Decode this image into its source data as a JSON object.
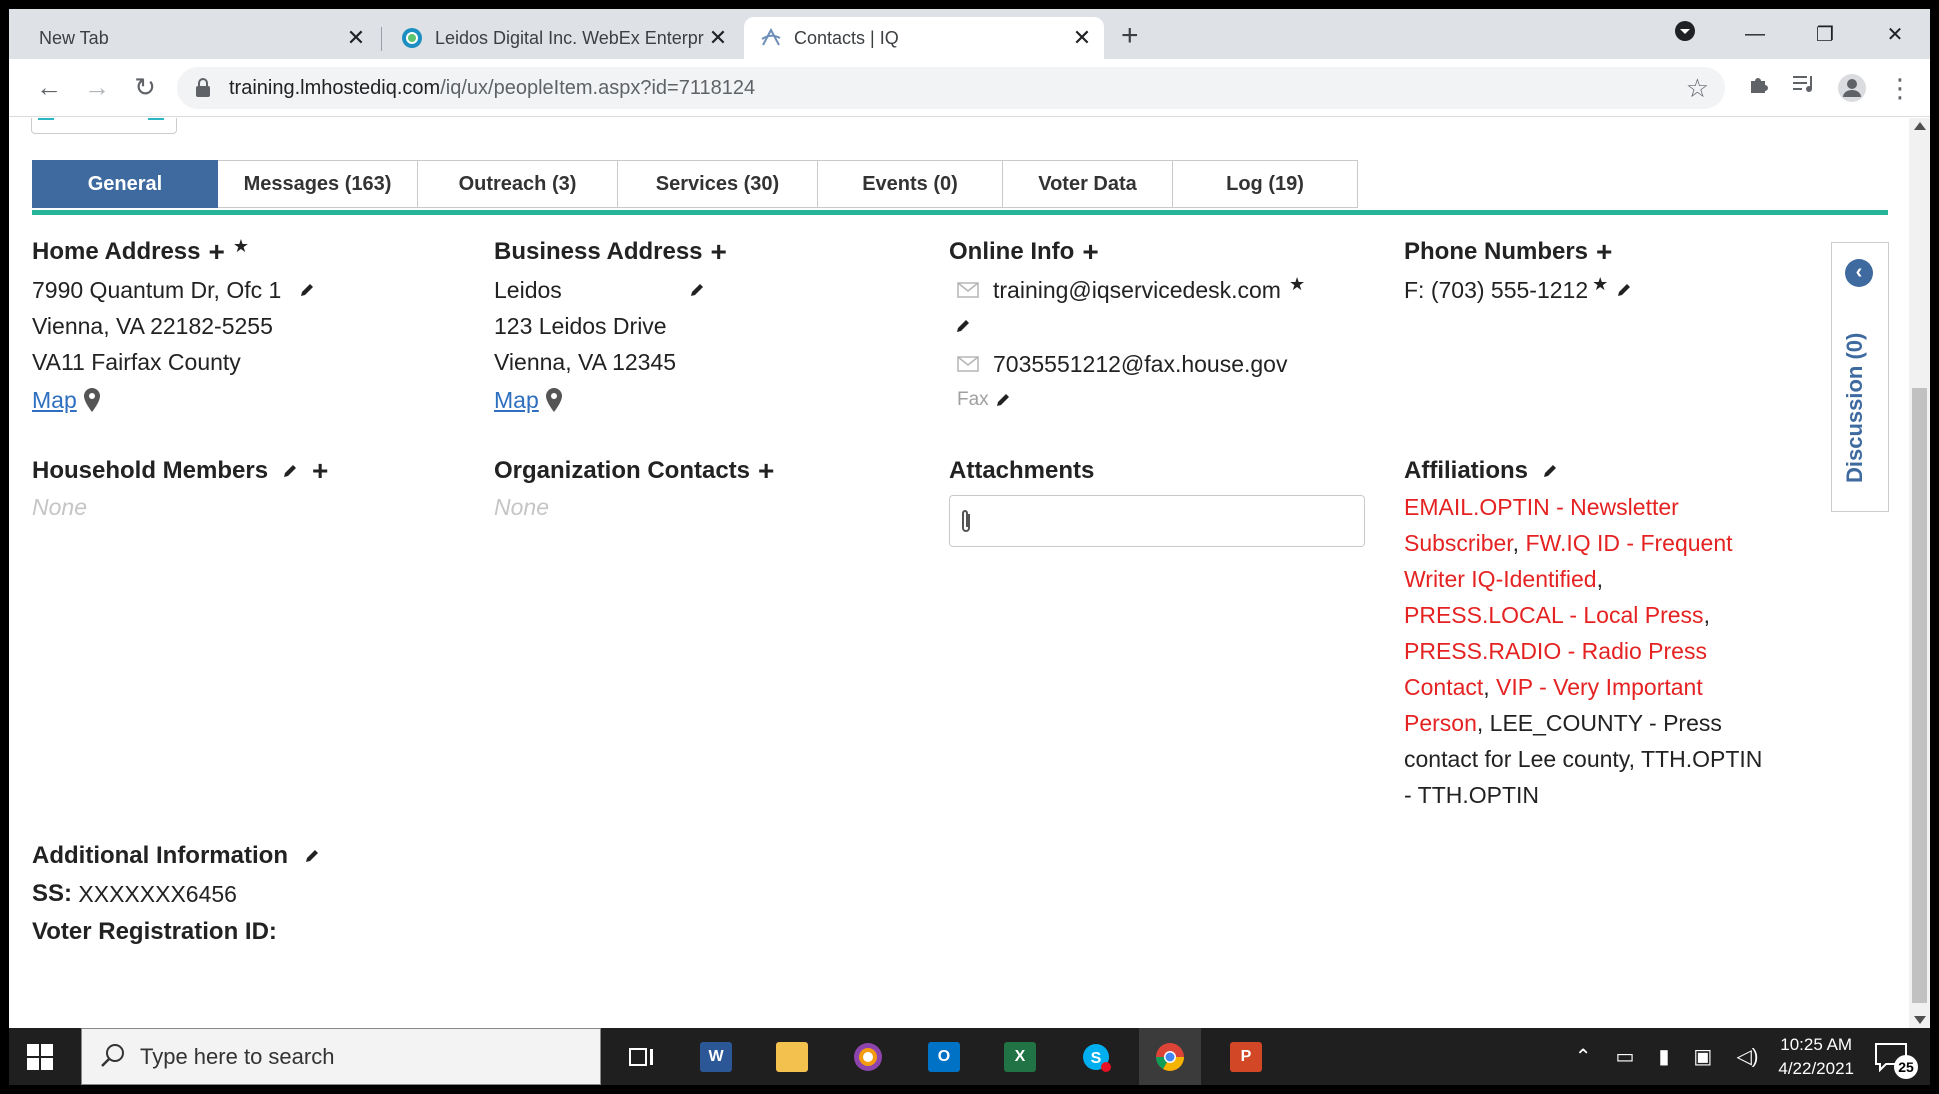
{
  "browser": {
    "tabs": [
      {
        "title": "New Tab",
        "active": false
      },
      {
        "title": "Leidos Digital Inc. WebEx Enterpr",
        "active": false
      },
      {
        "title": "Contacts | IQ",
        "active": true
      }
    ],
    "url_host": "training.lmhostediq.com",
    "url_path": "/iq/ux/peopleItem.aspx?id=7118124"
  },
  "page_tabs": [
    {
      "label": "General",
      "active": true
    },
    {
      "label": "Messages (163)",
      "active": false
    },
    {
      "label": "Outreach (3)",
      "active": false
    },
    {
      "label": "Services (30)",
      "active": false
    },
    {
      "label": "Events (0)",
      "active": false
    },
    {
      "label": "Voter Data",
      "active": false
    },
    {
      "label": "Log (19)",
      "active": false
    }
  ],
  "home_address": {
    "title": "Home Address",
    "lines": [
      "7990 Quantum Dr, Ofc 1",
      "Vienna, VA 22182-5255",
      "VA11 Fairfax County"
    ],
    "map_label": "Map"
  },
  "business_address": {
    "title": "Business Address",
    "lines": [
      "Leidos",
      "123 Leidos Drive",
      "Vienna, VA 12345"
    ],
    "map_label": "Map"
  },
  "online_info": {
    "title": "Online Info",
    "email": "training@iqservicedesk.com",
    "fax_email": "7035551212@fax.house.gov",
    "fax_label": "Fax"
  },
  "phone_numbers": {
    "title": "Phone Numbers",
    "fax": "F: (703) 555-1212"
  },
  "household": {
    "title": "Household Members",
    "empty": "None"
  },
  "org_contacts": {
    "title": "Organization Contacts",
    "empty": "None"
  },
  "attachments": {
    "title": "Attachments"
  },
  "affiliations": {
    "title": "Affiliations",
    "items": [
      {
        "code": "EMAIL.OPTIN",
        "desc": "Newsletter Subscriber",
        "highlight": true
      },
      {
        "code": "FW.IQ ID",
        "desc": "Frequent Writer IQ-Identified",
        "highlight": true
      },
      {
        "code": "PRESS.LOCAL",
        "desc": "Local Press",
        "highlight": true
      },
      {
        "code": "PRESS.RADIO",
        "desc": "Radio Press Contact",
        "highlight": true
      },
      {
        "code": "VIP",
        "desc": "Very Important Person",
        "highlight": true
      },
      {
        "code": "LEE_COUNTY",
        "desc": "Press contact for Lee county",
        "highlight": false
      },
      {
        "code": "TTH.OPTIN",
        "desc": "TTH.OPTIN",
        "highlight": false
      }
    ]
  },
  "additional_info": {
    "title": "Additional Information",
    "ss_label": "SS:",
    "ss_value": "XXXXXXX6456",
    "voter_label": "Voter Registration ID:"
  },
  "discussion": {
    "label": "Discussion (0)"
  },
  "taskbar": {
    "search_placeholder": "Type here to search",
    "time": "10:25 AM",
    "date": "4/22/2021",
    "notification_count": "25"
  },
  "colors": {
    "tab_active": "#3e6aa0",
    "accent_line": "#26b59a",
    "affiliation_red": "#e52222",
    "link_blue": "#2f6fbf"
  }
}
